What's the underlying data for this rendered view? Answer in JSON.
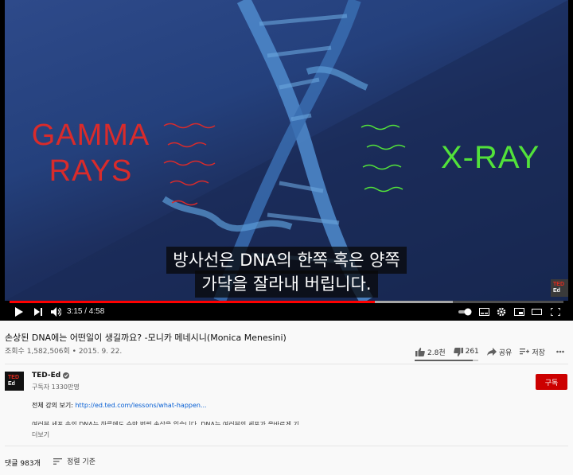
{
  "video": {
    "left_text": "GAMMA RAYS",
    "left_line1": "GAMMA",
    "left_line2": "RAYS",
    "right_text": "X-RAY",
    "subtitle_line1": "방사선은 DNA의 한쪽 혹은 양쪽",
    "subtitle_line2": "가닥을 잘라내 버립니다.",
    "watermark_top": "TED",
    "watermark_bottom": "Ed",
    "progress_played_fraction": 0.66,
    "progress_loaded_fraction": 0.8
  },
  "player": {
    "time_current": "3:15",
    "time_separator": "/",
    "time_total": "4:58",
    "timecode": "3:15 / 4:58"
  },
  "info": {
    "title": "손상된 DNA에는 어떤일이 생길까요? -모니카 메네시니(Monica Menesini)",
    "views": "조회수 1,582,506회",
    "date": "2015. 9. 22.",
    "meta": "조회수 1,582,506회 • 2015. 9. 22.",
    "likes": "2.8천",
    "dislikes": "261",
    "share": "공유",
    "save": "저장",
    "like_ratio": 0.91
  },
  "channel": {
    "name": "TED-Ed",
    "subscribers": "구독자 1330만명",
    "subscribe_label": "구독",
    "avatar_top": "TED",
    "avatar_bottom": "Ed"
  },
  "description": {
    "line1_prefix": "전체 강의 보기: ",
    "line1_link": "http://ed.ted.com/lessons/what-happen...",
    "line2": "여러분 세포 속의 DNA는 하루에도 수만 번씩 손상을 입습니다. DNA는 여러분의 세포가 올바르게 기",
    "more": "더보기"
  },
  "comments": {
    "count": "댓글 983개",
    "sort": "정렬 기준"
  },
  "colors": {
    "gamma": "#d92b2b",
    "xray": "#52e23a",
    "progress": "#ff0000",
    "subscribe": "#cc0000",
    "link": "#065fd4"
  }
}
